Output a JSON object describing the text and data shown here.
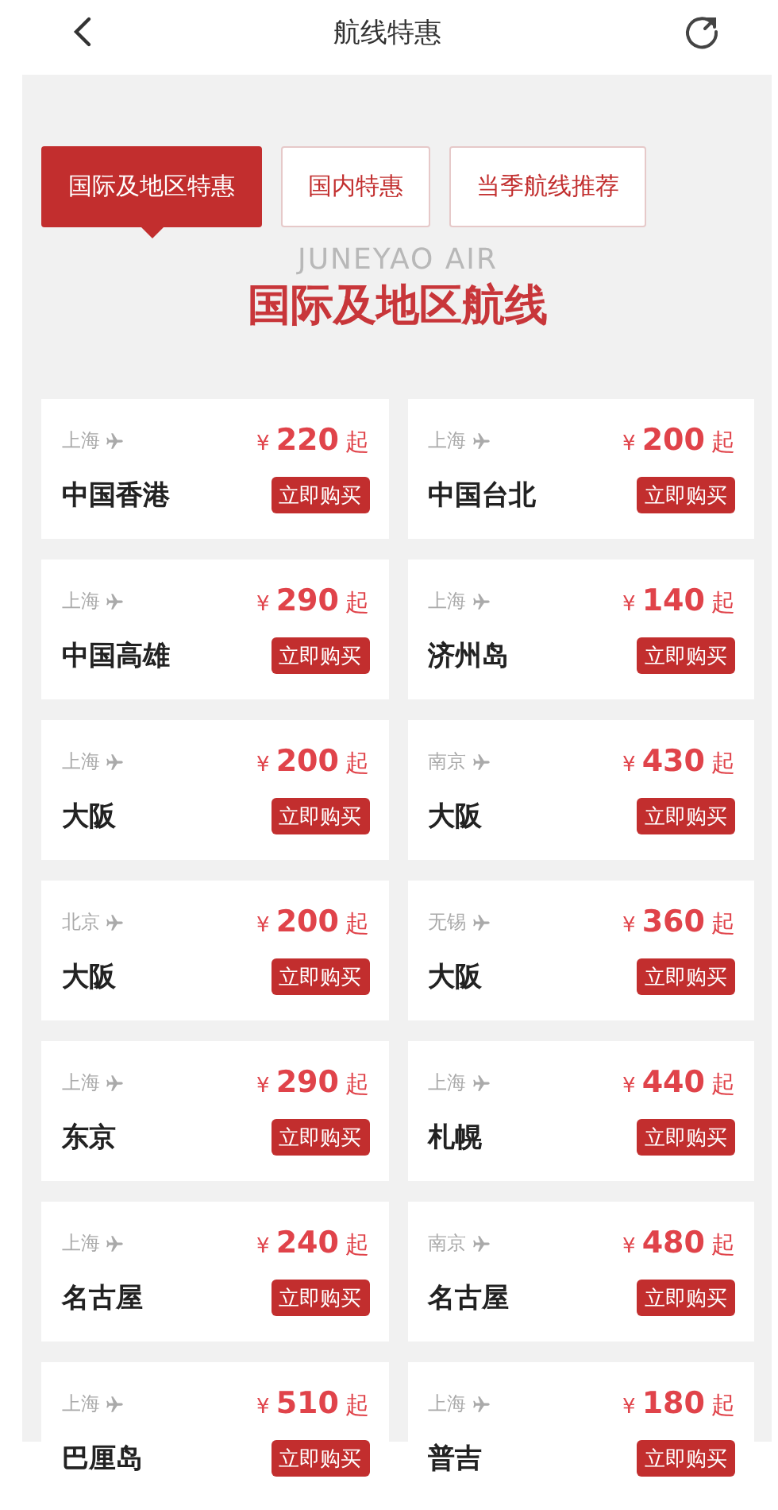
{
  "header": {
    "title": "航线特惠"
  },
  "tabs": [
    {
      "label": "国际及地区特惠",
      "selected": true
    },
    {
      "label": "国内特惠",
      "selected": false
    },
    {
      "label": "当季航线推荐",
      "selected": false
    }
  ],
  "brand_backdrop": "JUNEYAO AIR",
  "section_title": "国际及地区航线",
  "routes": [
    {
      "origin": "上海",
      "currency": "¥",
      "amount": "220",
      "suffix": "起",
      "destination": "中国香港",
      "button": "立即购买"
    },
    {
      "origin": "上海",
      "currency": "¥",
      "amount": "200",
      "suffix": "起",
      "destination": "中国台北",
      "button": "立即购买"
    },
    {
      "origin": "上海",
      "currency": "¥",
      "amount": "290",
      "suffix": "起",
      "destination": "中国高雄",
      "button": "立即购买"
    },
    {
      "origin": "上海",
      "currency": "¥",
      "amount": "140",
      "suffix": "起",
      "destination": "济州岛",
      "button": "立即购买"
    },
    {
      "origin": "上海",
      "currency": "¥",
      "amount": "200",
      "suffix": "起",
      "destination": "大阪",
      "button": "立即购买"
    },
    {
      "origin": "南京",
      "currency": "¥",
      "amount": "430",
      "suffix": "起",
      "destination": "大阪",
      "button": "立即购买"
    },
    {
      "origin": "北京",
      "currency": "¥",
      "amount": "200",
      "suffix": "起",
      "destination": "大阪",
      "button": "立即购买"
    },
    {
      "origin": "无锡",
      "currency": "¥",
      "amount": "360",
      "suffix": "起",
      "destination": "大阪",
      "button": "立即购买"
    },
    {
      "origin": "上海",
      "currency": "¥",
      "amount": "290",
      "suffix": "起",
      "destination": "东京",
      "button": "立即购买"
    },
    {
      "origin": "上海",
      "currency": "¥",
      "amount": "440",
      "suffix": "起",
      "destination": "札幌",
      "button": "立即购买"
    },
    {
      "origin": "上海",
      "currency": "¥",
      "amount": "240",
      "suffix": "起",
      "destination": "名古屋",
      "button": "立即购买"
    },
    {
      "origin": "南京",
      "currency": "¥",
      "amount": "480",
      "suffix": "起",
      "destination": "名古屋",
      "button": "立即购买"
    },
    {
      "origin": "上海",
      "currency": "¥",
      "amount": "510",
      "suffix": "起",
      "destination": "巴厘岛",
      "button": "立即购买"
    },
    {
      "origin": "上海",
      "currency": "¥",
      "amount": "180",
      "suffix": "起",
      "destination": "普吉",
      "button": "立即购买"
    }
  ]
}
